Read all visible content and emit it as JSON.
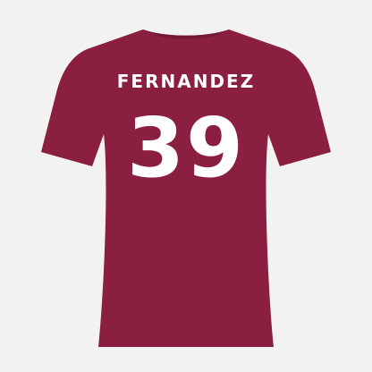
{
  "product": {
    "name_print": "FERNANDEZ",
    "number_print": "39"
  },
  "colors": {
    "background": "#f2f2f2",
    "shirt": "#8b1f3f",
    "shirt_shadow": "#741833",
    "print": "#ffffff"
  }
}
